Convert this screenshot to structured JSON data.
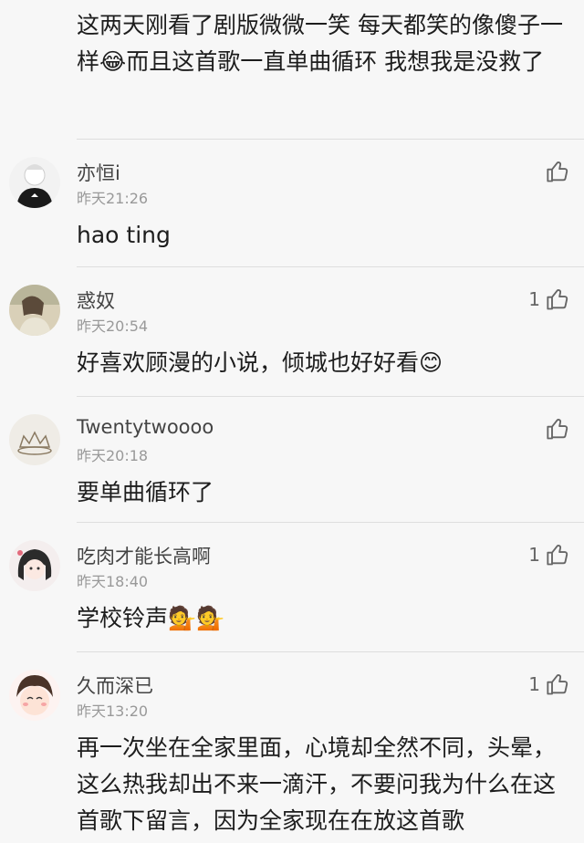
{
  "previous_comment": {
    "text": "这两天刚看了剧版微微一笑  每天都笑的像傻子一样😂而且这首歌一直单曲循环   我想我是没救了"
  },
  "comments": [
    {
      "username": "亦恒i",
      "time": "昨天21:26",
      "likes": "",
      "text": "hao ting",
      "avatar": "adidas-boy-avatar"
    },
    {
      "username": "惑奴",
      "time": "昨天20:54",
      "likes": "1",
      "text": "好喜欢顾漫的小说，倾城也好好看😊",
      "avatar": "girl-reading-avatar"
    },
    {
      "username": "Twentytwoooo",
      "time": "昨天20:18",
      "likes": "",
      "text": "要单曲循环了",
      "avatar": "crown-avatar"
    },
    {
      "username": "吃肉才能长高啊",
      "time": "昨天18:40",
      "likes": "1",
      "text": "学校铃声💁💁",
      "avatar": "anime-girl-avatar"
    },
    {
      "username": "久而深已",
      "time": "昨天13:20",
      "likes": "1",
      "text": "再一次坐在全家里面，心境却全然不同，头晕，这么热我却出不来一滴汗，不要问我为什么在这首歌下留言，因为全家现在在放这首歌",
      "avatar": "cartoon-face-avatar"
    }
  ],
  "icons": {
    "like": "thumbs-up-icon"
  },
  "colors": {
    "background": "#f7f7f7",
    "text": "#1d1d1d",
    "meta": "#999999",
    "divider": "#dedede"
  }
}
